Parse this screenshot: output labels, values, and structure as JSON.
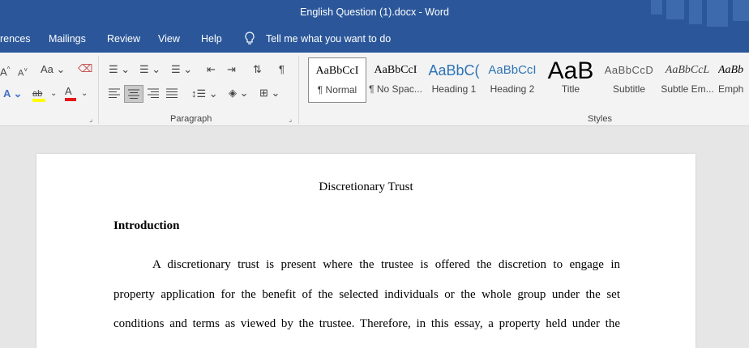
{
  "window": {
    "title": "English Question (1).docx  -  Word"
  },
  "menu": {
    "references": "rences",
    "mailings": "Mailings",
    "review": "Review",
    "view": "View",
    "help": "Help",
    "tell_me": "Tell me what you want to do"
  },
  "ribbon": {
    "font_group": {
      "change_case": "Aa"
    },
    "paragraph_label": "Paragraph",
    "styles_label": "Styles",
    "styles": [
      {
        "preview": "AaBbCcI",
        "name": "¶ Normal"
      },
      {
        "preview": "AaBbCcI",
        "name": "¶ No Spac..."
      },
      {
        "preview": "AaBbC(",
        "name": "Heading 1"
      },
      {
        "preview": "AaBbCcI",
        "name": "Heading 2"
      },
      {
        "preview": "AaB",
        "name": "Title"
      },
      {
        "preview": "AaBbCcD",
        "name": "Subtitle"
      },
      {
        "preview": "AaBbCcL",
        "name": "Subtle Em..."
      },
      {
        "preview": "AaBb",
        "name": "Emph"
      }
    ]
  },
  "document": {
    "title": "Discretionary Trust",
    "heading": "Introduction",
    "lines": [
      "A discretionary trust is present where the trustee is offered the discretion to engage in",
      "property application for the benefit of the selected individuals or the whole group under the set",
      "conditions and terms as viewed by the trustee. Therefore, in this essay, a property held under the"
    ]
  },
  "colors": {
    "brand": "#2b579a",
    "ribbon": "#f3f3f3",
    "canvas": "#e6e6e6"
  }
}
